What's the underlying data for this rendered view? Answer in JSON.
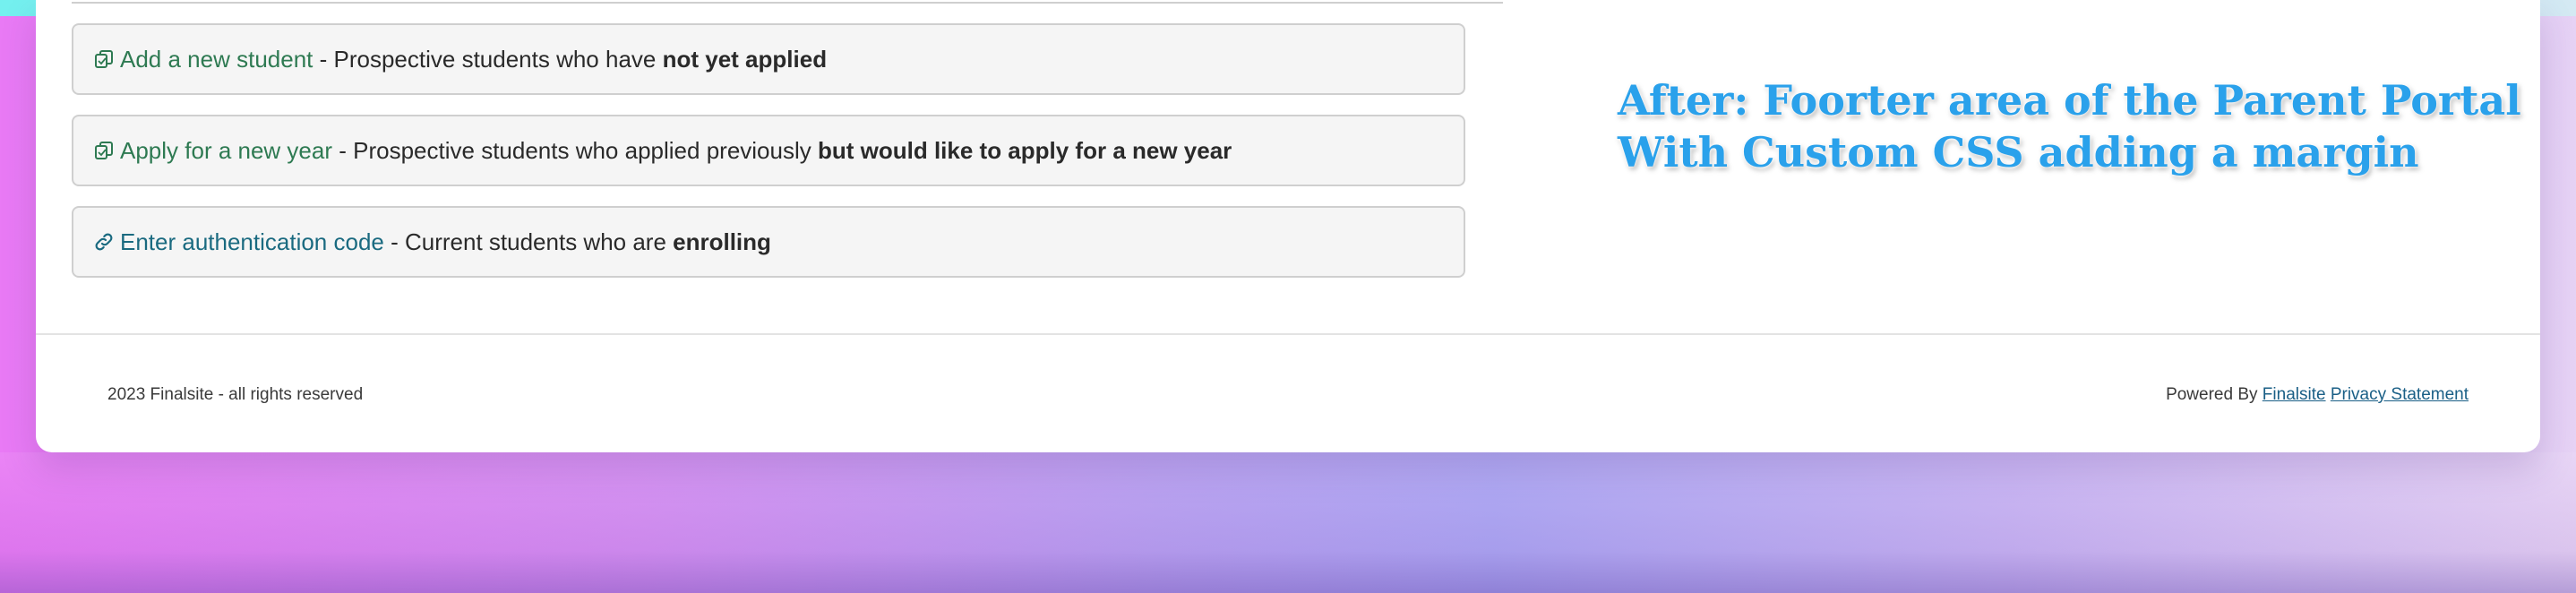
{
  "options": [
    {
      "icon": "copy-icon",
      "link": "Add a new student",
      "separator": " - ",
      "description": "Prospective students who have ",
      "emphasis": "not yet applied"
    },
    {
      "icon": "copy-icon",
      "link": "Apply for a new year",
      "separator": " - ",
      "description": "Prospective students who applied previously ",
      "emphasis": "but would like to apply for a new year"
    },
    {
      "icon": "link-icon",
      "link": "Enter authentication code",
      "separator": " - ",
      "description": "Current students who are ",
      "emphasis": "enrolling"
    }
  ],
  "annotation": {
    "line1": "After: Foorter area of the Parent Portal",
    "line2": "With Custom CSS adding a margin",
    "color": "#2aa1eb"
  },
  "footer": {
    "copyright": "2023 Finalsite - all rights reserved",
    "powered_by": "Powered By ",
    "brand_link": "Finalsite",
    "privacy_link": "Privacy Statement"
  },
  "colors": {
    "link_green": "#2e7a52",
    "link_teal": "#1a6a80",
    "footer_link": "#1a5f86"
  }
}
